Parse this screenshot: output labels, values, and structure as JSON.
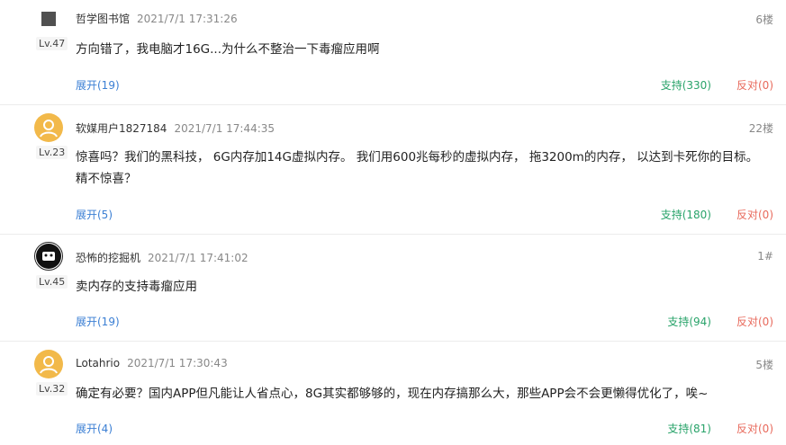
{
  "comments": [
    {
      "user": "哲学图书馆",
      "time": "2021/7/1 17:31:26",
      "floor": "6楼",
      "level": "Lv.47",
      "content": "方向错了，我电脑才16G...为什么不整治一下毒瘤应用啊",
      "expand": "展开(19)",
      "support": "支持(330)",
      "oppose": "反对(0)"
    },
    {
      "user": "软媒用户1827184",
      "time": "2021/7/1 17:44:35",
      "floor": "22楼",
      "level": "Lv.23",
      "content": "惊喜吗？我们的黑科技， 6G内存加14G虚拟内存。 我们用600兆每秒的虚拟内存， 拖3200m的内存， 以达到卡死你的目标。 精不惊喜？",
      "expand": "展开(5)",
      "support": "支持(180)",
      "oppose": "反对(0)"
    },
    {
      "user": "恐怖的挖掘机",
      "time": "2021/7/1 17:41:02",
      "floor": "1#",
      "level": "Lv.45",
      "content": "卖内存的支持毒瘤应用",
      "expand": "展开(19)",
      "support": "支持(94)",
      "oppose": "反对(0)"
    },
    {
      "user": "Lotahrio",
      "time": "2021/7/1 17:30:43",
      "floor": "5楼",
      "level": "Lv.32",
      "content": "确定有必要？国内APP但凡能让人省点心，8G其实都够够的，现在内存搞那么大，那些APP会不会更懒得优化了，唉~",
      "expand": "展开(4)",
      "support": "支持(81)",
      "oppose": "反对(0)"
    }
  ],
  "colors": {
    "expand": "#3b7fd4",
    "support": "#29a36a",
    "oppose": "#e86a5c"
  }
}
